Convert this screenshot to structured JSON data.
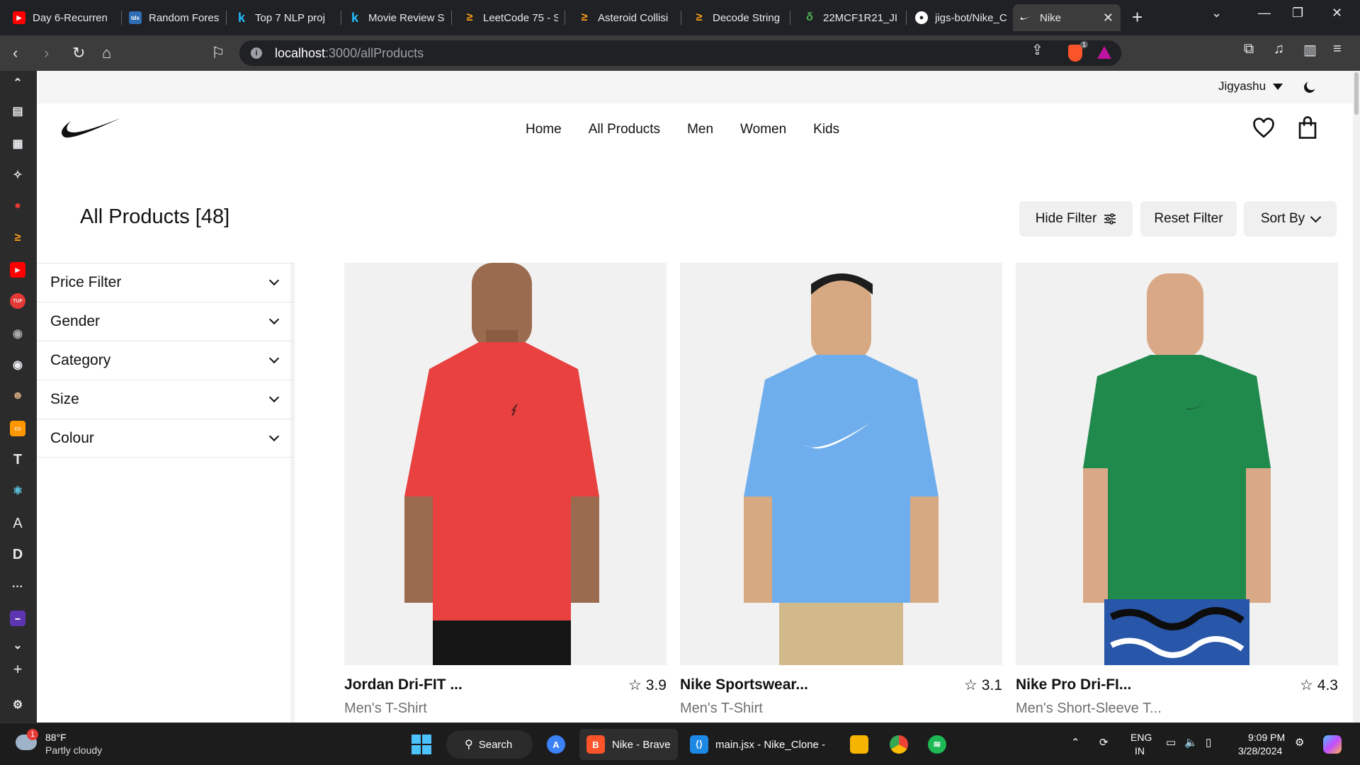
{
  "browser": {
    "tabs": [
      {
        "title": "Day 6-Recurren",
        "icon": "youtube-icon",
        "color": "#ff0000"
      },
      {
        "title": "Random Forest",
        "icon": "tds-icon",
        "color": "#2f6db5"
      },
      {
        "title": "Top 7 NLP proj",
        "icon": "kaggle-icon",
        "color": "#20beff"
      },
      {
        "title": "Movie Review S",
        "icon": "kaggle-icon",
        "color": "#20beff"
      },
      {
        "title": "LeetCode 75 - S",
        "icon": "leetcode-icon",
        "color": "#ffa116"
      },
      {
        "title": "Asteroid Collisi",
        "icon": "leetcode-icon",
        "color": "#ffa116"
      },
      {
        "title": "Decode String",
        "icon": "leetcode-icon",
        "color": "#ffa116"
      },
      {
        "title": "22MCF1R21_JI",
        "icon": "leaf-icon",
        "color": "#4caf50"
      },
      {
        "title": "jigs-bot/Nike_C",
        "icon": "github-icon",
        "color": "#ffffff"
      },
      {
        "title": "Nike",
        "icon": "nike-icon",
        "color": "#ffffff"
      }
    ],
    "url_host": "localhost",
    "url_path": ":3000/allProducts"
  },
  "header": {
    "username": "Jigyashu",
    "nav": [
      "Home",
      "All Products",
      "Men",
      "Women",
      "Kids"
    ]
  },
  "page": {
    "title": "All Products [48]",
    "hide_filter": "Hide Filter",
    "reset_filter": "Reset Filter",
    "sort_by": "Sort By"
  },
  "filters": [
    "Price Filter",
    "Gender",
    "Category",
    "Size",
    "Colour"
  ],
  "products": [
    {
      "name": "Jordan Dri-FIT ...",
      "rating": "3.9",
      "subtitle": "Men's T-Shirt",
      "shirt_color": "#e8413f"
    },
    {
      "name": "Nike Sportswear...",
      "rating": "3.1",
      "subtitle": "Men's T-Shirt",
      "shirt_color": "#6faeed"
    },
    {
      "name": "Nike Pro Dri-FI...",
      "rating": "4.3",
      "subtitle": "Men's Short-Sleeve T...",
      "shirt_color": "#1f8a4c"
    }
  ],
  "taskbar": {
    "weather_temp": "88°F",
    "weather_desc": "Partly cloudy",
    "weather_badge": "1",
    "search": "Search",
    "apps": [
      {
        "label": "Nike - Brave",
        "icon": "brave-icon"
      },
      {
        "label": "main.jsx - Nike_Clone -",
        "icon": "vscode-icon"
      }
    ],
    "lang": "ENG",
    "region": "IN",
    "time": "9:09 PM",
    "date": "3/28/2024"
  }
}
